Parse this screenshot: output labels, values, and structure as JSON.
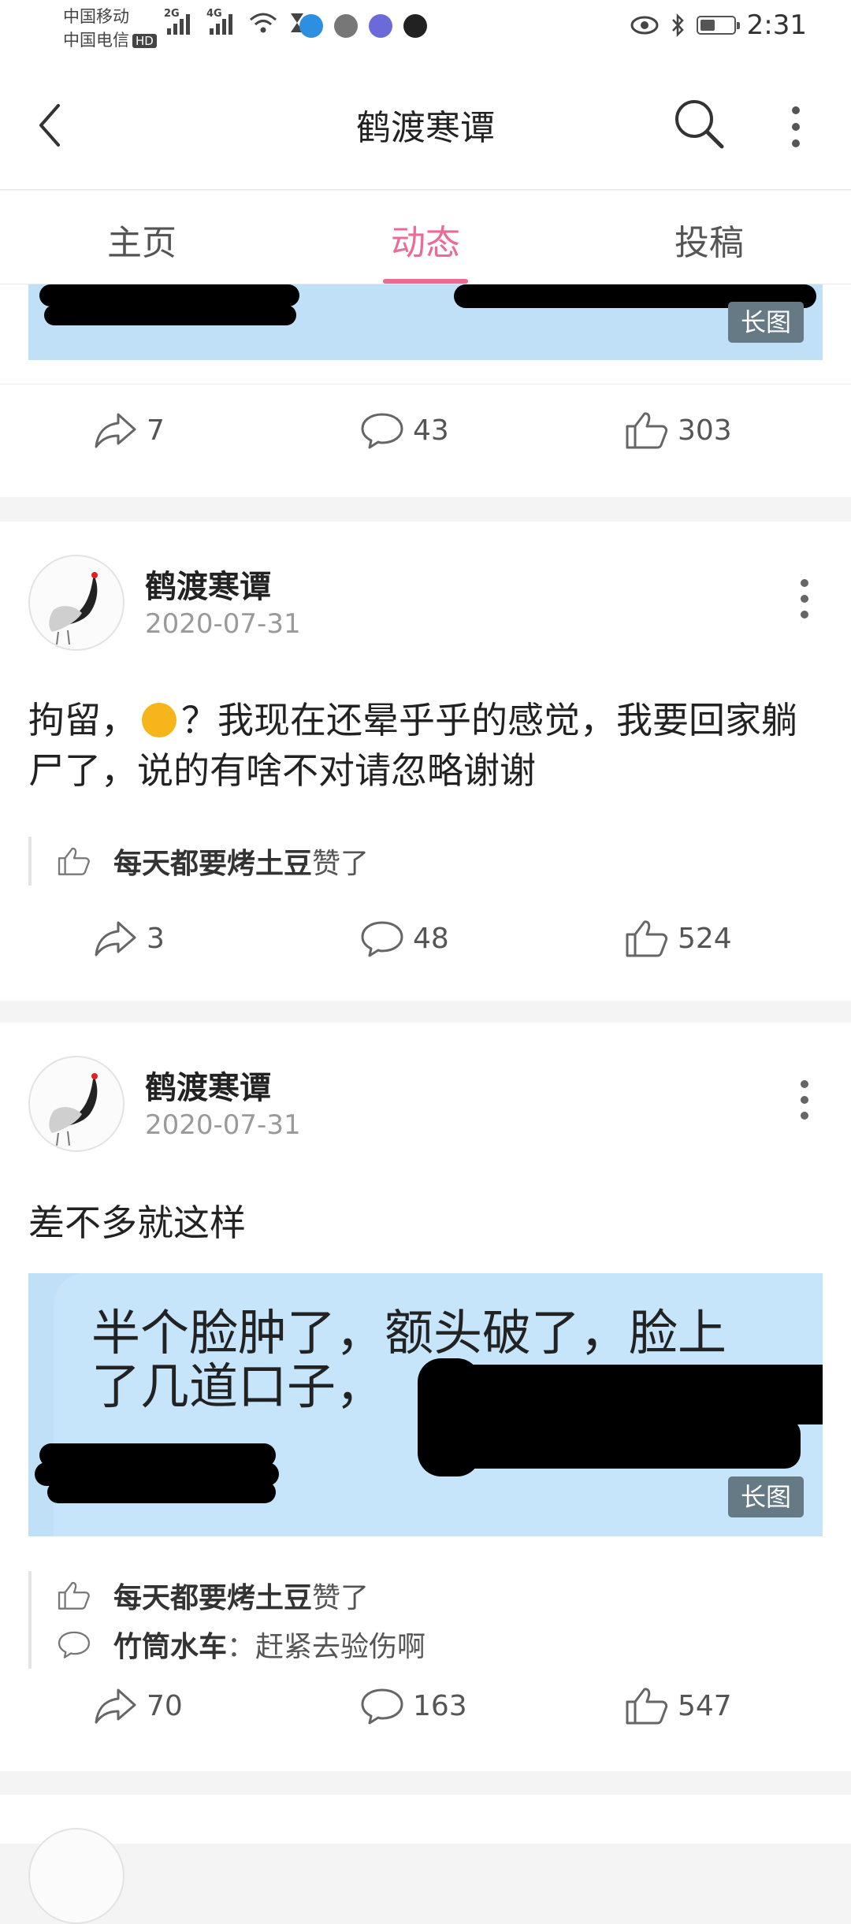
{
  "status_bar": {
    "carrier1": "中国移动",
    "carrier2": "中国电信",
    "hd_badge": "HD",
    "net1": "2G",
    "net2": "4G",
    "time": "2:31"
  },
  "header": {
    "title": "鹤渡寒谭"
  },
  "tabs": [
    {
      "label": "主页"
    },
    {
      "label": "动态"
    },
    {
      "label": "投稿"
    }
  ],
  "active_tab": "动态",
  "colors": {
    "accent": "#eb6b95",
    "image_bg": "#bfe0f7"
  },
  "posts": [
    {
      "long_image_tag": "长图",
      "shares": "7",
      "comments": "43",
      "likes": "303"
    },
    {
      "author": "鹤渡寒谭",
      "date": "2020-07-31",
      "text_before": "拘留，",
      "text_after": "？我现在还晕乎乎的感觉，我要回家躺尸了，说的有啥不对请忽略谢谢",
      "emoji_icon": "ok-hand-emoji",
      "liked_by": "每天都要烤土豆",
      "liked_suffix": "赞了",
      "shares": "3",
      "comments": "48",
      "likes": "524"
    },
    {
      "author": "鹤渡寒谭",
      "date": "2020-07-31",
      "text": "差不多就这样",
      "image_line1": "半个脸肿了，额头破了，脸上",
      "image_line2": "了几道口子，",
      "long_image_tag": "长图",
      "liked_by": "每天都要烤土豆",
      "liked_suffix": "赞了",
      "comment_author": "竹筒水车",
      "comment_text": "：赶紧去验伤啊",
      "shares": "70",
      "comments": "163",
      "likes": "547"
    }
  ]
}
